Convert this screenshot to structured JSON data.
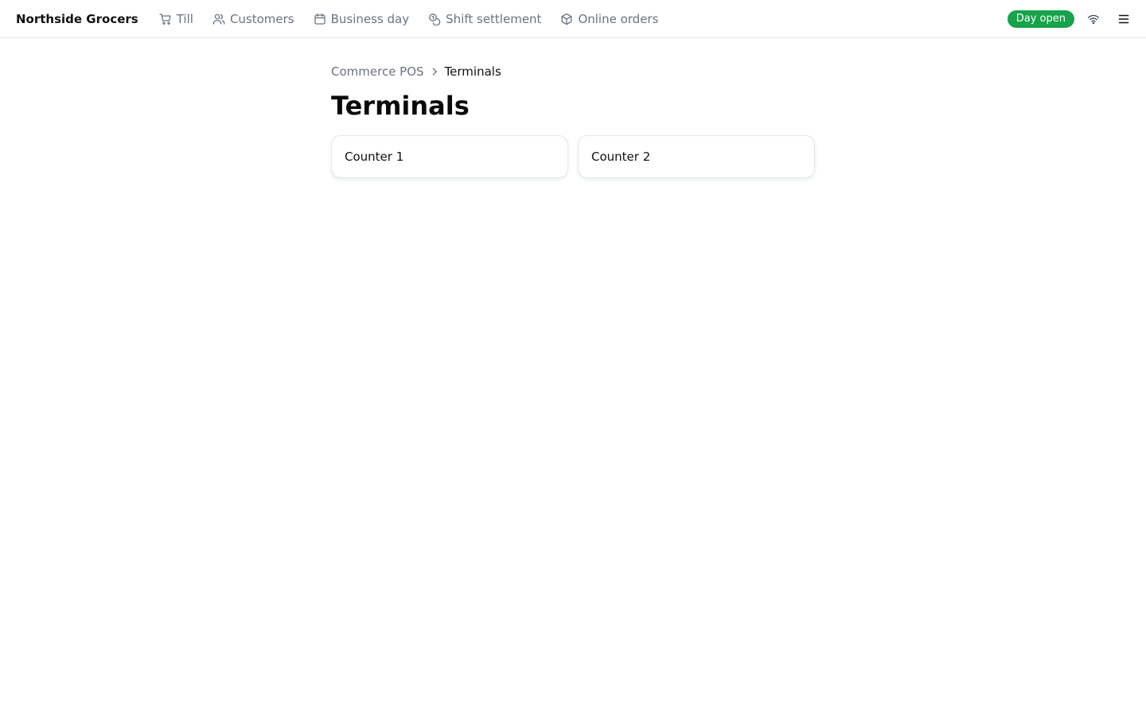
{
  "app": {
    "brand": "Northside Grocers"
  },
  "nav": {
    "items": [
      {
        "label": "Till",
        "icon": "cart-icon"
      },
      {
        "label": "Customers",
        "icon": "users-icon"
      },
      {
        "label": "Business day",
        "icon": "calendar-icon"
      },
      {
        "label": "Shift settlement",
        "icon": "coins-icon"
      },
      {
        "label": "Online orders",
        "icon": "package-icon"
      }
    ]
  },
  "status": {
    "badge": "Day open",
    "badge_color": "#16a34a",
    "connection_icon": "wifi-icon",
    "menu_icon": "hamburger-menu-icon"
  },
  "breadcrumb": {
    "parent": "Commerce POS",
    "separator_icon": "chevron-right-icon",
    "current": "Terminals"
  },
  "page": {
    "title": "Terminals"
  },
  "terminals": [
    {
      "name": "Counter 1"
    },
    {
      "name": "Counter 2"
    }
  ]
}
